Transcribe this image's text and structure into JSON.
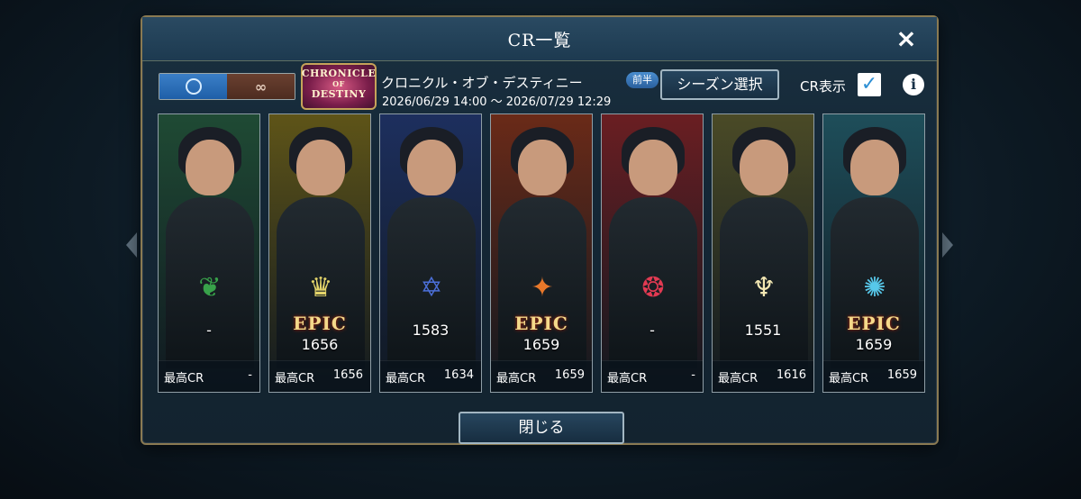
{
  "dialog": {
    "title": "CR一覧",
    "close_icon": "×",
    "close_button_label": "閉じる"
  },
  "filter_toggle": {
    "options": [
      {
        "icon": "hexagon-icon",
        "active": true,
        "color": "#2f74c0"
      },
      {
        "icon": "infinity-icon",
        "glyph": "∞",
        "active": false,
        "color": "#5a3526"
      }
    ]
  },
  "season": {
    "logo_lines": [
      "CHRONICLE",
      "OF",
      "DESTINY"
    ],
    "name": "クロニクル・オブ・デスティニー",
    "badge": "前半",
    "period": "2026/06/29 14:00 〜 2026/07/29 12:29",
    "select_button_label": "シーズン選択"
  },
  "cr_display": {
    "label": "CR表示",
    "checked": true,
    "check_glyph": "✓"
  },
  "info_button": {
    "glyph": "i"
  },
  "cards": [
    {
      "bg": "#1f4a34",
      "emblem": "leaf-icon",
      "emblem_glyph": "❦",
      "emblem_color": "#38a24a",
      "epic": "",
      "cr": "-",
      "best_label": "最高CR",
      "best_value": "-"
    },
    {
      "bg": "#5e5418",
      "emblem": "crown-icon",
      "emblem_glyph": "♛",
      "emblem_color": "#e3d46a",
      "epic": "EPIC",
      "cr": "1656",
      "best_label": "最高CR",
      "best_value": "1656"
    },
    {
      "bg": "#1d2f5e",
      "emblem": "star-hexagon-icon",
      "emblem_glyph": "✡",
      "emblem_color": "#4b6fd8",
      "epic": "",
      "cr": "1583",
      "best_label": "最高CR",
      "best_value": "1634"
    },
    {
      "bg": "#6a2a18",
      "emblem": "fox-icon",
      "emblem_glyph": "✦",
      "emblem_color": "#e8782a",
      "epic": "EPIC",
      "cr": "1659",
      "best_label": "最高CR",
      "best_value": "1659"
    },
    {
      "bg": "#6a1e22",
      "emblem": "demon-icon",
      "emblem_glyph": "❂",
      "emblem_color": "#e23a52",
      "epic": "",
      "cr": "-",
      "best_label": "最高CR",
      "best_value": "-"
    },
    {
      "bg": "#4a4a26",
      "emblem": "claw-icon",
      "emblem_glyph": "♆",
      "emblem_color": "#f3e7b3",
      "epic": "",
      "cr": "1551",
      "best_label": "最高CR",
      "best_value": "1616"
    },
    {
      "bg": "#1e4e5a",
      "emblem": "spiral-icon",
      "emblem_glyph": "✺",
      "emblem_color": "#57c8ea",
      "epic": "EPIC",
      "cr": "1659",
      "best_label": "最高CR",
      "best_value": "1659"
    }
  ]
}
